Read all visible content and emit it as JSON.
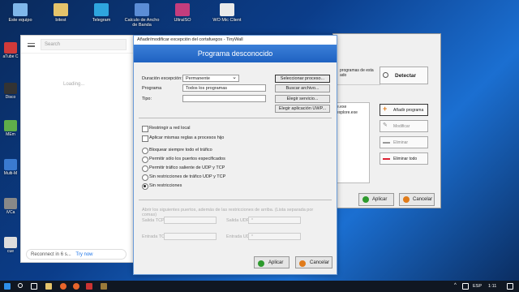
{
  "desktop": {
    "top_icons": [
      {
        "label": "Este equipo",
        "icon": "computer-icon",
        "color": "#7fb7ea"
      },
      {
        "label": "bitest",
        "icon": "folder-icon",
        "color": "#e5c46b"
      },
      {
        "label": "Telegram",
        "icon": "telegram-icon",
        "color": "#2ea5de"
      },
      {
        "label": "Calculo de Ancho de Banda",
        "icon": "calculator-icon",
        "color": "#5b8dd6"
      },
      {
        "label": "UltraISO",
        "icon": "disc-icon",
        "color": "#c43d7d"
      },
      {
        "label": "WO Mic Client",
        "icon": "mic-icon",
        "color": "#eaeaea"
      }
    ],
    "left_icons": [
      {
        "label": "aTube C",
        "icon": "atube-icon",
        "color": "#d03a3a"
      },
      {
        "label": "Disco",
        "icon": "disc-icon",
        "color": "#333"
      },
      {
        "label": "MEm",
        "icon": "android-icon",
        "color": "#5fae4a"
      },
      {
        "label": "Multi-M",
        "icon": "app-icon",
        "color": "#3a7ad0"
      },
      {
        "label": "iVCa",
        "icon": "camera-icon",
        "color": "#888"
      },
      {
        "label": "cue",
        "icon": "file-icon",
        "color": "#ddd"
      }
    ]
  },
  "side_window": {
    "search_placeholder": "Search",
    "loading_text": "Loading...",
    "reconnect_text": "Reconnect in 6 s...",
    "try_now": "Try now"
  },
  "back_window": {
    "info_text": "programas de esta",
    "info_text2": "ado",
    "list_items": [
      "e.exe",
      "explore.exe"
    ],
    "buttons": {
      "detect": "Detectar",
      "add_program": "Añadir programa",
      "modify": "Modificar",
      "remove": "Eliminar",
      "remove_all": "Eliminar todo"
    },
    "apply": "Aplicar",
    "cancel": "Cancelar"
  },
  "dialog": {
    "title": "Añadir/modificar excepción del cortafuegos - TinyWall",
    "header": "Programa desconocido",
    "labels": {
      "duration": "Duración excepción:",
      "program": "Programa",
      "type": "Tipo:"
    },
    "duration_value": "Permanente",
    "program_value": "Todos los programas",
    "type_value": "",
    "buttons": {
      "select_process": "Seleccionar proceso...",
      "browse_file": "Buscar archivo...",
      "choose_service": "Elegir servicio...",
      "choose_uwp": "Elegir aplicación UWP..."
    },
    "checkboxes": [
      "Restringir a red local",
      "Aplicar mismas reglas a procesos hijo"
    ],
    "radios": [
      "Bloquear siempre todo el tráfico",
      "Permitir sólo los puertos especificados",
      "Permitir tráfico saliente de UDP y TCP",
      "Sin restricciones de tráfico UDP y TCP",
      "Sin restricciones"
    ],
    "selected_radio": 4,
    "ports_hint": "Abrir los siguientes puertos, además de las restricciones de arriba. (Lista separada por comas)",
    "ports": {
      "tcp_out": "Salida TCP:",
      "udp_out": "Salida UDP:",
      "tcp_in": "Entrada TCP:",
      "udp_in": "Entrada UD:",
      "udp_out_value": "*",
      "udp_in_value": "*"
    },
    "apply": "Aplicar",
    "cancel": "Cancelar",
    "colors": {
      "header": "#2a6fd0",
      "apply_dot": "#2d9a2d",
      "cancel_dot": "#e07b1a"
    }
  },
  "taskbar": {
    "language": "ESP",
    "time": "1:11"
  }
}
